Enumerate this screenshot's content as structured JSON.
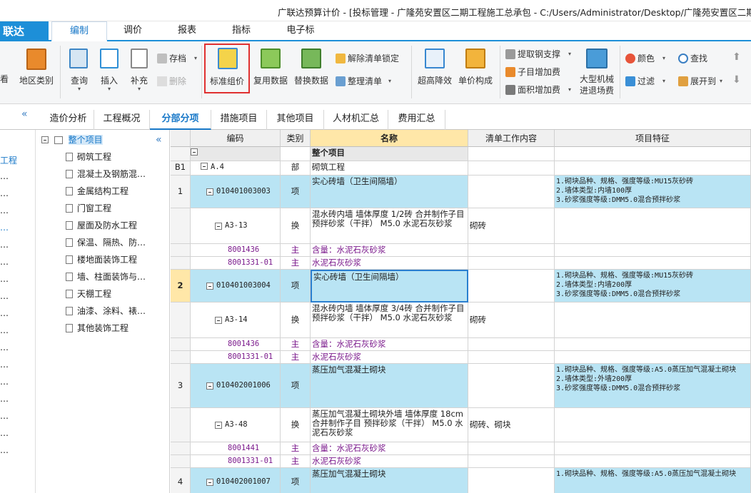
{
  "window": {
    "title": "广联达预算计价 - [投标管理 - 广隆苑安置区二期工程施工总承包 - C:/Users/Administrator/Desktop/广隆苑安置区二期工"
  },
  "menubar": {
    "brand": "联达",
    "tabs": [
      "编制",
      "调价",
      "报表",
      "指标",
      "电子标"
    ]
  },
  "ribbon": {
    "partial_left": "看",
    "area_category": "地区类别",
    "query": "查询",
    "insert": "插入",
    "supplement": "补充",
    "archive": "存档",
    "delete": "删除",
    "standard_pricing": "标准组价",
    "reuse_data": "复用数据",
    "replace_data": "替换数据",
    "unlock_list": "解除清单锁定",
    "organize_list": "整理清单",
    "over_height_reduction": "超高降效",
    "unit_price_composition": "单价构成",
    "extract_rebar_support": "提取钢支撑",
    "sub_item_increase": "子目增加费",
    "area_increase": "面积增加费",
    "large_machinery": "大型机械",
    "entry_exit": "进退场费",
    "color": "颜色",
    "search": "查找",
    "filter": "过滤",
    "expand_to": "展开到"
  },
  "colors": {
    "accent": "#1d8fd8",
    "highlight_row": "#b9e4f4",
    "header_key": "#ffe7a8",
    "purple_text": "#7b1a8c",
    "red_box": "#e03030"
  },
  "page_tabs": [
    "造价分析",
    "工程概况",
    "分部分项",
    "措施项目",
    "其他项目",
    "人材机汇总",
    "费用汇总"
  ],
  "active_page_tab": "分部分项",
  "left_strip": {
    "items": [
      "工程",
      "…",
      "…",
      "…",
      "…",
      "…",
      "…",
      "…",
      "…",
      "…",
      "…",
      "…",
      "…",
      "…",
      "…",
      "…",
      "…",
      "…"
    ]
  },
  "tree": {
    "root": "整个项目",
    "children": [
      "砌筑工程",
      "混凝土及钢筋混…",
      "金属结构工程",
      "门窗工程",
      "屋面及防水工程",
      "保温、隔热、防…",
      "楼地面装饰工程",
      "墙、柱面装饰与…",
      "天棚工程",
      "油漆、涂料、裱…",
      "其他装饰工程"
    ]
  },
  "grid": {
    "columns": [
      "编码",
      "类别",
      "名称",
      "清单工作内容",
      "项目特征"
    ],
    "rows": [
      {
        "seq": "",
        "code": "",
        "type": "",
        "name": "整个项目",
        "work": "",
        "feature": ""
      },
      {
        "seq": "B1",
        "code": "A.4",
        "type": "部",
        "name": "砌筑工程",
        "work": "",
        "feature": ""
      },
      {
        "seq": "1",
        "code": "010401003003",
        "type": "项",
        "name": "实心砖墙（卫生间隔墙）",
        "work": "",
        "feature": "1.砌块品种、规格、强度等级:MU15灰砂砖\n2.墙体类型:内墙100厚\n3.砂浆强度等级:DMM5.0混合预拌砂浆"
      },
      {
        "seq": "",
        "code": "A3-13",
        "type": "换",
        "name": "混水砖内墙 墙体厚度 1/2砖  合并制作子目 预拌砂浆（干拌） M5.0 水泥石灰砂浆",
        "work": "砌砖",
        "feature": ""
      },
      {
        "seq": "",
        "code": "8001436",
        "type": "主",
        "name": "含量：水泥石灰砂浆",
        "work": "",
        "feature": ""
      },
      {
        "seq": "",
        "code": "8001331-01",
        "type": "主",
        "name": "水泥石灰砂浆",
        "work": "",
        "feature": ""
      },
      {
        "seq": "2",
        "code": "010401003004",
        "type": "项",
        "name": "实心砖墙（卫生间隔墙）",
        "work": "",
        "feature": "1.砌块品种、规格、强度等级:MU15灰砂砖\n2.墙体类型:内墙200厚\n3.砂浆强度等级:DMM5.0混合预拌砂浆"
      },
      {
        "seq": "",
        "code": "A3-14",
        "type": "换",
        "name": "混水砖内墙 墙体厚度 3/4砖  合并制作子目 预拌砂浆（干拌） M5.0 水泥石灰砂浆",
        "work": "砌砖",
        "feature": ""
      },
      {
        "seq": "",
        "code": "8001436",
        "type": "主",
        "name": "含量：水泥石灰砂浆",
        "work": "",
        "feature": ""
      },
      {
        "seq": "",
        "code": "8001331-01",
        "type": "主",
        "name": "水泥石灰砂浆",
        "work": "",
        "feature": ""
      },
      {
        "seq": "3",
        "code": "010402001006",
        "type": "项",
        "name": "蒸压加气混凝土砌块",
        "work": "",
        "feature": "1.砌块品种、规格、强度等级:A5.0蒸压加气混凝土砌块\n2.墙体类型:外墙200厚\n3.砂浆强度等级:DMM5.0混合预拌砂浆"
      },
      {
        "seq": "",
        "code": "A3-48",
        "type": "换",
        "name": "蒸压加气混凝土砌块外墙 墙体厚度 18cm  合并制作子目 预拌砂浆（干拌） M5.0 水泥石灰砂浆",
        "work": "砌砖、砌块",
        "feature": ""
      },
      {
        "seq": "",
        "code": "8001441",
        "type": "主",
        "name": "含量：水泥石灰砂浆",
        "work": "",
        "feature": ""
      },
      {
        "seq": "",
        "code": "8001331-01",
        "type": "主",
        "name": "水泥石灰砂浆",
        "work": "",
        "feature": ""
      },
      {
        "seq": "4",
        "code": "010402001007",
        "type": "项",
        "name": "蒸压加气混凝土砌块",
        "work": "",
        "feature": "1.砌块品种、规格、强度等级:A5.0蒸压加气混凝土砌块"
      }
    ]
  }
}
